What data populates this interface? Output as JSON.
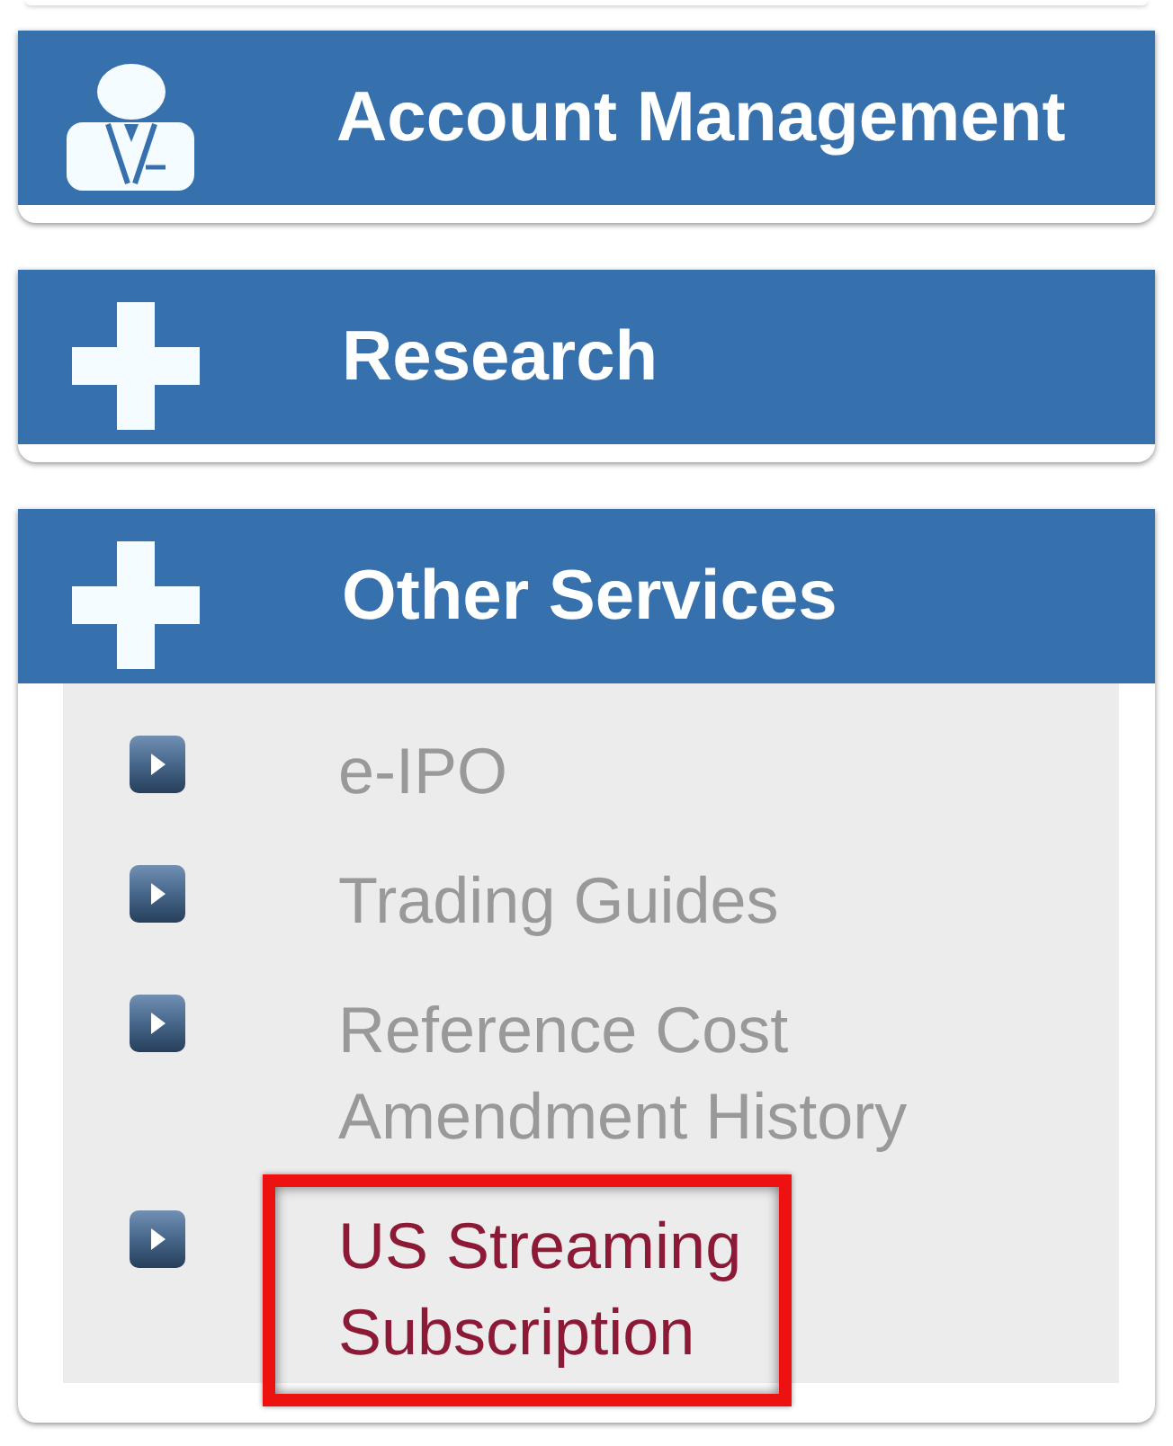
{
  "panels": [
    {
      "kind": "account",
      "title": "Account Management",
      "expanded": false
    },
    {
      "kind": "expandable",
      "title": "Research",
      "expanded": false
    },
    {
      "kind": "expandable",
      "title": "Other Services",
      "expanded": true,
      "items": [
        {
          "label": "e-IPO",
          "selected": false,
          "highlighted": false
        },
        {
          "label": "Trading Guides",
          "selected": false,
          "highlighted": false
        },
        {
          "label": "Reference Cost Amendment History",
          "selected": false,
          "highlighted": false
        },
        {
          "label": "US Streaming Subscription",
          "selected": true,
          "highlighted": true
        }
      ]
    }
  ]
}
